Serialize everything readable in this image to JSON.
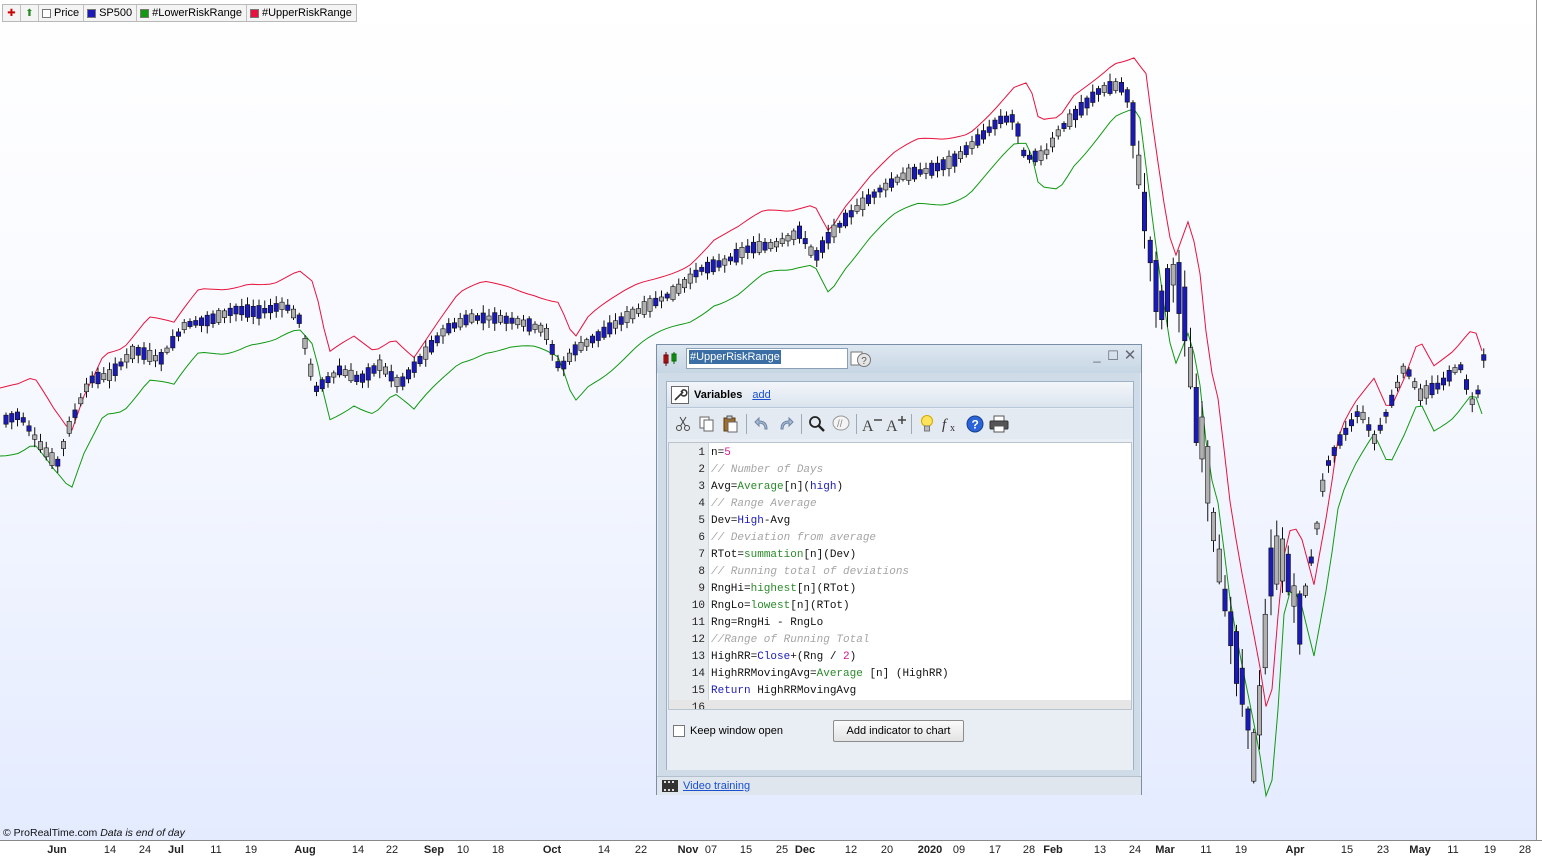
{
  "legend": {
    "items": [
      {
        "label": "Price",
        "color": "#ffffff"
      },
      {
        "label": "SP500",
        "color": "#1a1ab8"
      },
      {
        "label": "#LowerRiskRange",
        "color": "#119911"
      },
      {
        "label": "#UpperRiskRange",
        "color": "#e8123c"
      }
    ]
  },
  "credit": {
    "brand": "© ProRealTime.com",
    "note": "Data is end of day"
  },
  "date_axis": {
    "labels": [
      {
        "text": "Jun",
        "major": true
      },
      {
        "text": "14",
        "major": false
      },
      {
        "text": "24",
        "major": false
      },
      {
        "text": "Jul",
        "major": true
      },
      {
        "text": "11",
        "major": false
      },
      {
        "text": "19",
        "major": false
      },
      {
        "text": "Aug",
        "major": true
      },
      {
        "text": "14",
        "major": false
      },
      {
        "text": "22",
        "major": false
      },
      {
        "text": "Sep",
        "major": true
      },
      {
        "text": "10",
        "major": false
      },
      {
        "text": "18",
        "major": false
      },
      {
        "text": "Oct",
        "major": true
      },
      {
        "text": "14",
        "major": false
      },
      {
        "text": "22",
        "major": false
      },
      {
        "text": "Nov",
        "major": true
      },
      {
        "text": "07",
        "major": false
      },
      {
        "text": "15",
        "major": false
      },
      {
        "text": "25",
        "major": false
      },
      {
        "text": "Dec",
        "major": true
      },
      {
        "text": "12",
        "major": false
      },
      {
        "text": "20",
        "major": false
      },
      {
        "text": "2020",
        "major": true
      },
      {
        "text": "09",
        "major": false
      },
      {
        "text": "17",
        "major": false
      },
      {
        "text": "28",
        "major": false
      },
      {
        "text": "Feb",
        "major": true
      },
      {
        "text": "13",
        "major": false
      },
      {
        "text": "24",
        "major": false
      },
      {
        "text": "Mar",
        "major": true
      },
      {
        "text": "11",
        "major": false
      },
      {
        "text": "19",
        "major": false
      },
      {
        "text": "Apr",
        "major": true
      },
      {
        "text": "15",
        "major": false
      },
      {
        "text": "23",
        "major": false
      },
      {
        "text": "May",
        "major": true
      },
      {
        "text": "11",
        "major": false
      },
      {
        "text": "19",
        "major": false
      },
      {
        "text": "28",
        "major": false
      }
    ]
  },
  "chart_data": {
    "type": "candlestick",
    "series": [
      {
        "name": "SP500"
      },
      {
        "name": "#LowerRiskRange"
      },
      {
        "name": "#UpperRiskRange"
      }
    ],
    "colors": {
      "up": "#1a1ab8",
      "down": "#b0b0b0",
      "lower": "#119911",
      "upper": "#e8123c"
    }
  },
  "dialog": {
    "name_value": "#UpperRiskRange",
    "variables_label": "Variables",
    "add_link": "add",
    "code_lines": [
      [
        {
          "t": "n="
        },
        {
          "t": "5",
          "c": "num"
        }
      ],
      [
        {
          "t": "// Number of Days",
          "c": "cmt"
        }
      ],
      [
        {
          "t": "Avg="
        },
        {
          "t": "Average",
          "c": "kw"
        },
        {
          "t": "[n]("
        },
        {
          "t": "high",
          "c": "hi"
        },
        {
          "t": ")"
        }
      ],
      [
        {
          "t": "// Range Average",
          "c": "cmt"
        }
      ],
      [
        {
          "t": "Dev="
        },
        {
          "t": "High",
          "c": "hi"
        },
        {
          "t": "-Avg"
        }
      ],
      [
        {
          "t": "// Deviation from average",
          "c": "cmt"
        }
      ],
      [
        {
          "t": "RTot="
        },
        {
          "t": "summation",
          "c": "kw"
        },
        {
          "t": "[n](Dev)"
        }
      ],
      [
        {
          "t": "// Running total of deviations",
          "c": "cmt"
        }
      ],
      [
        {
          "t": "RngHi="
        },
        {
          "t": "highest",
          "c": "kw"
        },
        {
          "t": "[n](RTot)"
        }
      ],
      [
        {
          "t": "RngLo="
        },
        {
          "t": "lowest",
          "c": "kw"
        },
        {
          "t": "[n](RTot)"
        }
      ],
      [
        {
          "t": "Rng=RngHi - RngLo"
        }
      ],
      [
        {
          "t": "//Range of Running Total",
          "c": "cmt"
        }
      ],
      [
        {
          "t": "HighRR="
        },
        {
          "t": "Close",
          "c": "hi"
        },
        {
          "t": "+(Rng / "
        },
        {
          "t": "2",
          "c": "num"
        },
        {
          "t": ")"
        }
      ],
      [
        {
          "t": "HighRRMovingAvg="
        },
        {
          "t": "Average",
          "c": "kw"
        },
        {
          "t": " [n] (HighRR)"
        }
      ],
      [
        {
          "t": "Return",
          "c": "ret"
        },
        {
          "t": " HighRRMovingAvg"
        }
      ],
      []
    ],
    "keep_open_label": "Keep window open",
    "add_button_label": "Add indicator to chart",
    "video_link": "Video training"
  }
}
